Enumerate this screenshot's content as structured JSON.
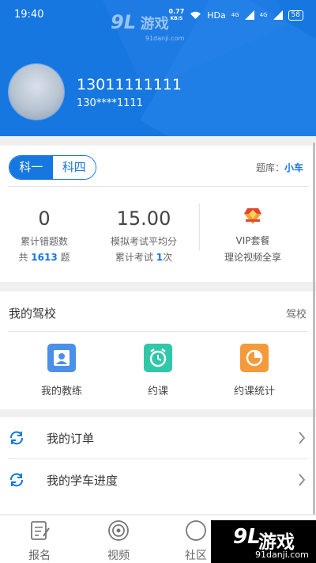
{
  "status_bar": {
    "time": "19:40",
    "speed_value": "0.77",
    "speed_unit": "KB/S",
    "hd_label": "HDa",
    "net1": "4G",
    "net2": "4G",
    "battery": "58"
  },
  "watermark": {
    "logo_number": "9L",
    "logo_text": "游戏",
    "domain": "91danji.com"
  },
  "profile": {
    "phone": "13011111111",
    "masked_phone": "130****1111"
  },
  "subjects": {
    "tabs": [
      "科一",
      "科四"
    ],
    "active": "科一",
    "bank_label": "题库：",
    "bank_value": "小车"
  },
  "stats": {
    "wrong": {
      "value": "0",
      "label": "累计错题数",
      "sub_prefix": "共 ",
      "sub_value": "1613",
      "sub_suffix": " 题"
    },
    "exam": {
      "value": "15.00",
      "label": "模拟考试平均分",
      "sub_prefix": "累计考试 ",
      "sub_value": "1",
      "sub_suffix": "次"
    },
    "vip": {
      "line1": "VIP套餐",
      "line2": "理论视频全享"
    }
  },
  "school": {
    "title": "我的驾校",
    "right_label": "驾校",
    "items": [
      {
        "label": "我的教练",
        "icon": "coach-icon",
        "color": "#4a8fe8"
      },
      {
        "label": "约课",
        "icon": "alarm-clock-icon",
        "color": "#2fc8a8"
      },
      {
        "label": "约课统计",
        "icon": "pie-chart-icon",
        "color": "#f59a3a"
      }
    ]
  },
  "menu": {
    "items": [
      {
        "label": "我的订单",
        "icon": "refresh-icon"
      },
      {
        "label": "我的学车进度",
        "icon": "refresh-icon"
      }
    ]
  },
  "nav": {
    "items": [
      {
        "label": "报名",
        "icon": "edit-form-icon"
      },
      {
        "label": "视频",
        "icon": "video-disc-icon"
      },
      {
        "label": "社区",
        "icon": "community-icon"
      }
    ]
  },
  "colors": {
    "primary": "#1677e0",
    "background": "#f0f0f0"
  }
}
